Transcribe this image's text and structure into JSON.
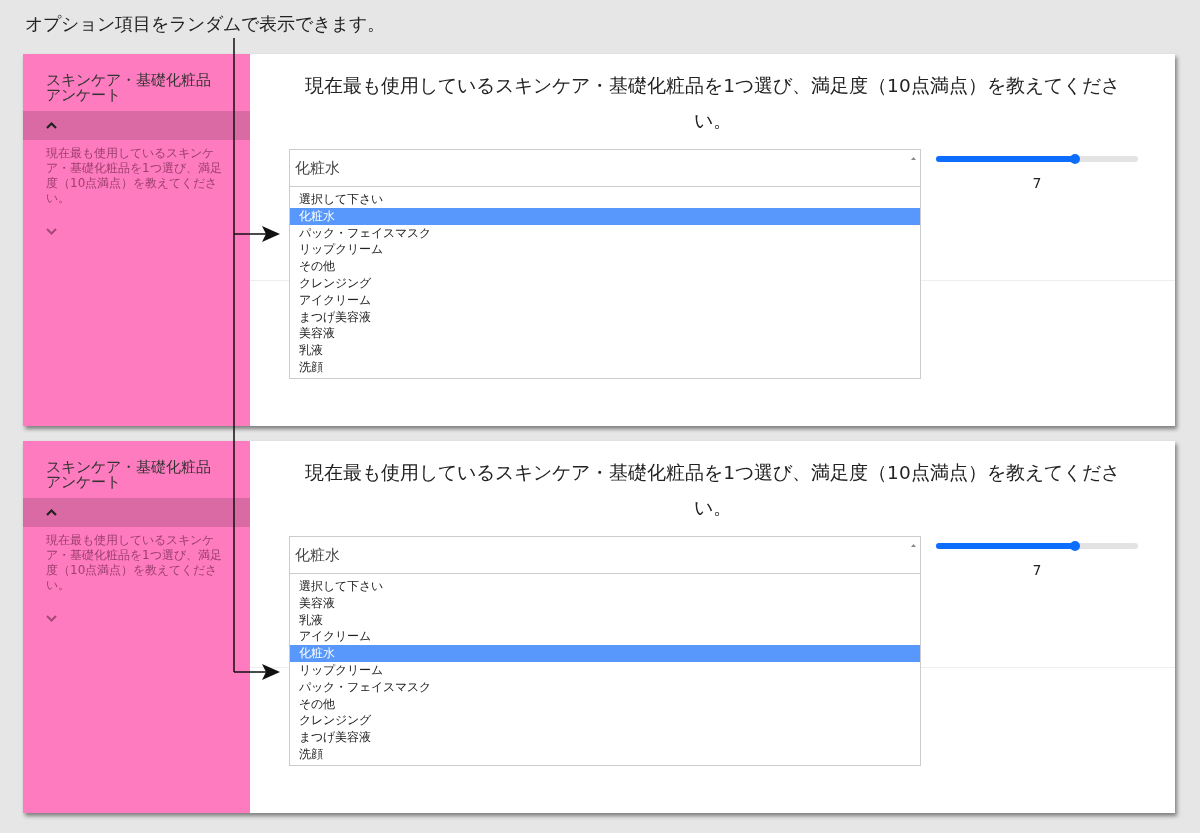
{
  "caption": "オプション項目をランダムで表示できます。",
  "panels": [
    {
      "sidebar_title": "スキンケア・基礎化粧品アンケート",
      "sidebar_question": "現在最も使用しているスキンケア・基礎化粧品を1つ選び、満足度（10点満点）を教えてください。",
      "question": "現在最も使用しているスキンケア・基礎化粧品を1つ選び、満足度（10点満点）を教えてください。",
      "select_value": "化粧水",
      "slider": {
        "level": 0.69,
        "reading": "7"
      },
      "options": [
        {
          "label": "選択して下さい",
          "selected": false
        },
        {
          "label": "化粧水",
          "selected": true
        },
        {
          "label": "パック・フェイスマスク",
          "selected": false
        },
        {
          "label": "リップクリーム",
          "selected": false
        },
        {
          "label": "その他",
          "selected": false
        },
        {
          "label": "クレンジング",
          "selected": false
        },
        {
          "label": "アイクリーム",
          "selected": false
        },
        {
          "label": "まつげ美容液",
          "selected": false
        },
        {
          "label": "美容液",
          "selected": false
        },
        {
          "label": "乳液",
          "selected": false
        },
        {
          "label": "洗顔",
          "selected": false
        }
      ]
    },
    {
      "sidebar_title": "スキンケア・基礎化粧品アンケート",
      "sidebar_question": "現在最も使用しているスキンケア・基礎化粧品を1つ選び、満足度（10点満点）を教えてください。",
      "question": "現在最も使用しているスキンケア・基礎化粧品を1つ選び、満足度（10点満点）を教えてください。",
      "select_value": "化粧水",
      "slider": {
        "level": 0.69,
        "reading": "7"
      },
      "options": [
        {
          "label": "選択して下さい",
          "selected": false
        },
        {
          "label": "美容液",
          "selected": false
        },
        {
          "label": "乳液",
          "selected": false
        },
        {
          "label": "アイクリーム",
          "selected": false
        },
        {
          "label": "化粧水",
          "selected": true
        },
        {
          "label": "リップクリーム",
          "selected": false
        },
        {
          "label": "パック・フェイスマスク",
          "selected": false
        },
        {
          "label": "その他",
          "selected": false
        },
        {
          "label": "クレンジング",
          "selected": false
        },
        {
          "label": "まつげ美容液",
          "selected": false
        },
        {
          "label": "洗顔",
          "selected": false
        }
      ]
    }
  ]
}
